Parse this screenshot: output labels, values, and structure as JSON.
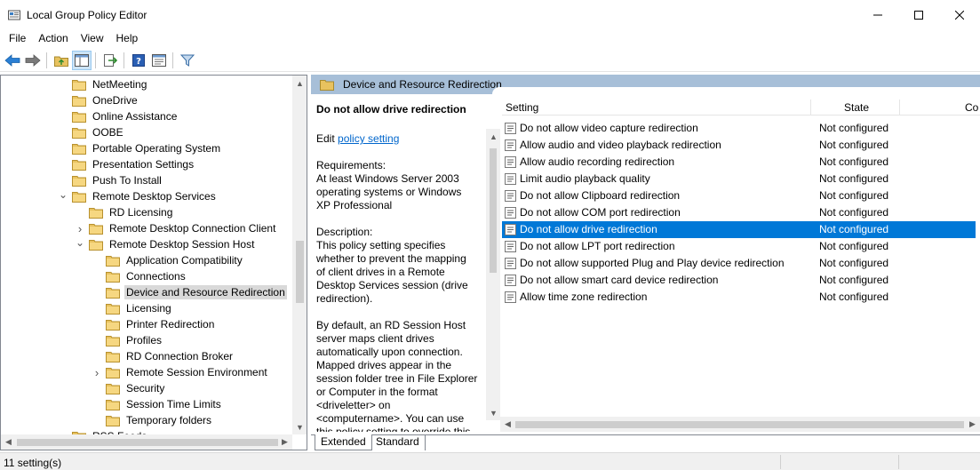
{
  "window": {
    "title": "Local Group Policy Editor",
    "controls": {
      "minimize": "–",
      "maximize": "☐",
      "close": "✕"
    }
  },
  "menu": [
    "File",
    "Action",
    "View",
    "Help"
  ],
  "toolbar": {
    "buttons": [
      "back-icon",
      "forward-icon",
      "up-folder-icon",
      "show-hide-tree-icon",
      "export-list-icon",
      "help-icon",
      "properties-icon",
      "filter-icon"
    ]
  },
  "tree": {
    "items": [
      {
        "label": "NetMeeting",
        "level": 2,
        "expander": ""
      },
      {
        "label": "OneDrive",
        "level": 2,
        "expander": ""
      },
      {
        "label": "Online Assistance",
        "level": 2,
        "expander": ""
      },
      {
        "label": "OOBE",
        "level": 2,
        "expander": ""
      },
      {
        "label": "Portable Operating System",
        "level": 2,
        "expander": ""
      },
      {
        "label": "Presentation Settings",
        "level": 2,
        "expander": ""
      },
      {
        "label": "Push To Install",
        "level": 2,
        "expander": ""
      },
      {
        "label": "Remote Desktop Services",
        "level": 2,
        "expander": "expanded"
      },
      {
        "label": "RD Licensing",
        "level": 3,
        "expander": ""
      },
      {
        "label": "Remote Desktop Connection Client",
        "level": 3,
        "expander": "collapsed"
      },
      {
        "label": "Remote Desktop Session Host",
        "level": 3,
        "expander": "expanded"
      },
      {
        "label": "Application Compatibility",
        "level": 4,
        "expander": ""
      },
      {
        "label": "Connections",
        "level": 4,
        "expander": ""
      },
      {
        "label": "Device and Resource Redirection",
        "level": 4,
        "expander": "",
        "selected": true
      },
      {
        "label": "Licensing",
        "level": 4,
        "expander": ""
      },
      {
        "label": "Printer Redirection",
        "level": 4,
        "expander": ""
      },
      {
        "label": "Profiles",
        "level": 4,
        "expander": ""
      },
      {
        "label": "RD Connection Broker",
        "level": 4,
        "expander": ""
      },
      {
        "label": "Remote Session Environment",
        "level": 4,
        "expander": "collapsed"
      },
      {
        "label": "Security",
        "level": 4,
        "expander": ""
      },
      {
        "label": "Session Time Limits",
        "level": 4,
        "expander": ""
      },
      {
        "label": "Temporary folders",
        "level": 4,
        "expander": ""
      },
      {
        "label": "RSS Feeds",
        "level": 2,
        "expander": ""
      }
    ]
  },
  "header": {
    "title": "Device and Resource Redirection"
  },
  "description": {
    "title": "Do not allow drive redirection",
    "edit_prefix": "Edit ",
    "edit_link": "policy setting",
    "requirements": "Requirements:\nAt least Windows Server 2003 operating systems or Windows XP Professional",
    "description": "Description:\nThis policy setting specifies whether to prevent the mapping of client drives in a Remote Desktop Services session (drive redirection).",
    "more": "By default, an RD Session Host server maps client drives automatically upon connection. Mapped drives appear in the session folder tree in File Explorer or Computer in the format <driveletter> on <computername>. You can use this policy setting to override this"
  },
  "list": {
    "columns": {
      "setting": "Setting",
      "state": "State",
      "comment": "Co"
    },
    "rows": [
      {
        "name": "Do not allow video capture redirection",
        "state": "Not configured"
      },
      {
        "name": "Allow audio and video playback redirection",
        "state": "Not configured"
      },
      {
        "name": "Allow audio recording redirection",
        "state": "Not configured"
      },
      {
        "name": "Limit audio playback quality",
        "state": "Not configured"
      },
      {
        "name": "Do not allow Clipboard redirection",
        "state": "Not configured"
      },
      {
        "name": "Do not allow COM port redirection",
        "state": "Not configured"
      },
      {
        "name": "Do not allow drive redirection",
        "state": "Not configured",
        "selected": true
      },
      {
        "name": "Do not allow LPT port redirection",
        "state": "Not configured"
      },
      {
        "name": "Do not allow supported Plug and Play device redirection",
        "state": "Not configured"
      },
      {
        "name": "Do not allow smart card device redirection",
        "state": "Not configured"
      },
      {
        "name": "Allow time zone redirection",
        "state": "Not configured"
      }
    ]
  },
  "tabs": {
    "extended": "Extended",
    "standard": "Standard"
  },
  "status": {
    "text": "11 setting(s)"
  },
  "colors": {
    "accent": "#0078d7",
    "header_band": "#a7bfd8",
    "folder": "#e8c25f"
  }
}
